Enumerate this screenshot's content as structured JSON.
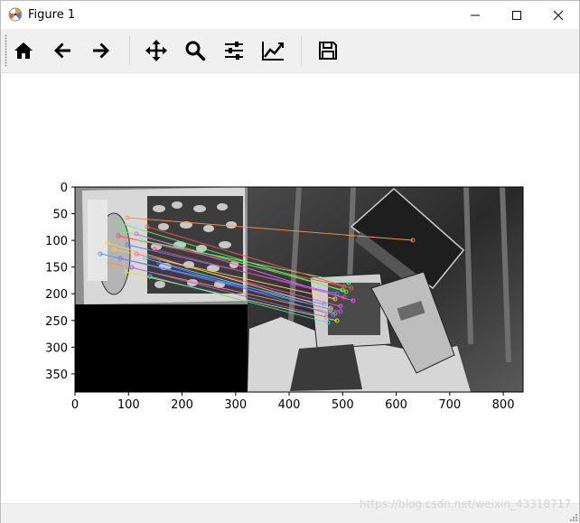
{
  "window": {
    "title": "Figure 1"
  },
  "toolbar": {
    "buttons": [
      {
        "name": "home",
        "icon": "home-icon"
      },
      {
        "name": "back",
        "icon": "arrow-left-icon"
      },
      {
        "name": "forward",
        "icon": "arrow-right-icon"
      },
      {
        "name": "pan",
        "icon": "move-icon"
      },
      {
        "name": "zoom",
        "icon": "search-icon"
      },
      {
        "name": "subplots",
        "icon": "sliders-icon"
      },
      {
        "name": "customize",
        "icon": "line-chart-icon"
      },
      {
        "name": "save",
        "icon": "save-icon"
      }
    ]
  },
  "plot": {
    "xticks": [
      "0",
      "100",
      "200",
      "300",
      "400",
      "500",
      "600",
      "700",
      "800"
    ],
    "yticks": [
      "0",
      "50",
      "100",
      "150",
      "200",
      "250",
      "300",
      "350"
    ],
    "xlim": [
      0,
      837
    ],
    "ylim": [
      384,
      0
    ]
  },
  "statusbar": {
    "watermark": "https://blog.csdn.net/weixin_43318717"
  }
}
